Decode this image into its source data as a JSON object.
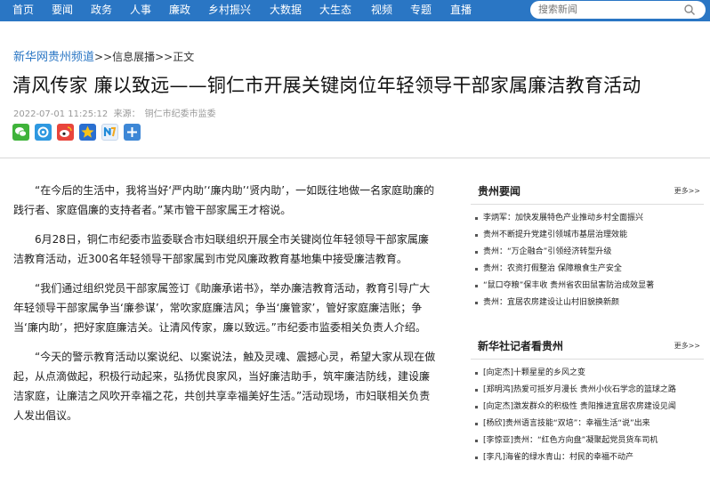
{
  "nav": {
    "items": [
      "首页",
      "要闻",
      "政务",
      "人事",
      "廉政",
      "乡村振兴",
      "大数据",
      "大生态",
      "视频",
      "专题",
      "直播"
    ],
    "search_placeholder": "搜索新闻",
    "bg_color": "#2a76c4"
  },
  "breadcrumb": {
    "home": "新华网贵州频道",
    "rest": ">>信息展播>>正文"
  },
  "article": {
    "title": "清风传家 廉以致远——铜仁市开展关键岗位年轻领导干部家属廉洁教育活动",
    "date": "2022-07-01 11:25:12",
    "source": "来源：　铜仁市纪委市监委",
    "share_icons": [
      "wechat-icon",
      "moments-icon",
      "weibo-icon",
      "qzone-icon",
      "toutiao-icon",
      "more-share-icon"
    ],
    "paragraphs": [
      "“在今后的生活中，我将当好‘严内助’‘廉内助’‘贤内助’，一如既往地做一名家庭助廉的践行者、家庭倡廉的支持者者。”某市管干部家属王才榕说。",
      "6月28日，铜仁市纪委市监委联合市妇联组织开展全市关键岗位年轻领导干部家属廉洁教育活动，近300名年轻领导干部家属到市党风廉政教育基地集中接受廉洁教育。",
      "“我们通过组织党员干部家属签订《助廉承诺书》，举办廉洁教育活动，教育引导广大年轻领导干部家属争当‘廉参谋’，常吹家庭廉洁风；争当‘廉管家’，管好家庭廉洁账；争当‘廉内助’，把好家庭廉洁关。让清风传家，廉以致远。”市纪委市监委相关负责人介绍。",
      "“今天的警示教育活动以案说纪、以案说法，触及灵魂、震撼心灵，希望大家从现在做起，从点滴做起，积极行动起来，弘扬优良家风，当好廉洁助手，筑牢廉洁防线，建设廉洁家庭，让廉洁之风吹开幸福之花，共创共享幸福美好生活。”活动现场，市妇联相关负责人发出倡议。"
    ]
  },
  "sidebar": {
    "sections": [
      {
        "title": "贵州要闻",
        "more": "更多>>",
        "items": [
          "李炳军：加快发展特色产业推动乡村全面振兴",
          "贵州不断提升党建引领城市基层治理效能",
          "贵州：“万企融合”引领经济转型升级",
          "贵州：农资打假整治 保障粮食生产安全",
          "“鼠口夺粮”保丰收 贵州省农田鼠害防治成效显著",
          "贵州：宜居农房建设让山村旧貌换新颜"
        ]
      },
      {
        "title": "新华社记者看贵州",
        "more": "更多>>",
        "items": [
          "[向定杰]十颗星星的乡风之变",
          "[郑明鸿]热爱可抵岁月漫长 贵州小伙石学念的篮球之路",
          "[向定杰]激发群众的积极性 贵阳推进宜居农房建设见闻",
          "[杨欣]贵州语言技能“双培”：幸福生活“说”出来",
          "[李惊亚]贵州：“红色方向盘”凝聚起党员货车司机",
          "[李凡]海雀的绿水青山：村民的幸福不动产"
        ]
      }
    ]
  }
}
